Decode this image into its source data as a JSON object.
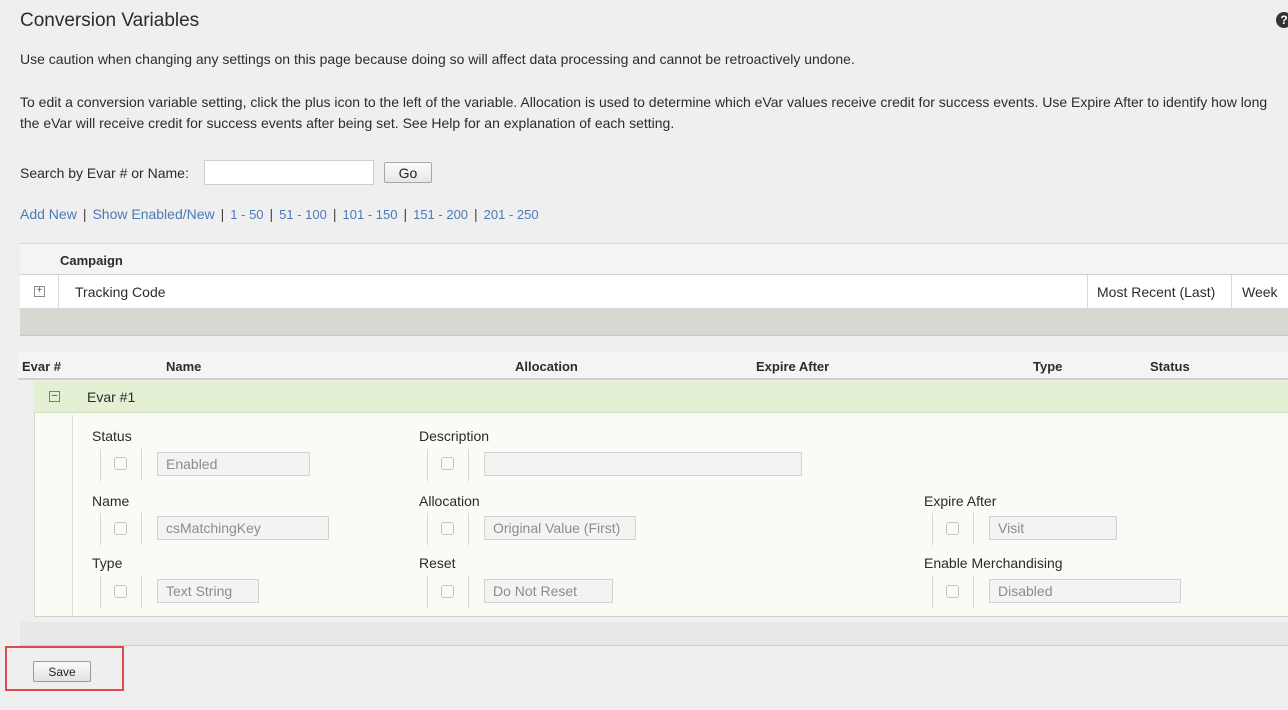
{
  "page": {
    "title": "Conversion Variables",
    "help_icon": "?",
    "caution_text": "Use caution when changing any settings on this page because doing so will affect data processing and cannot be retroactively undone.",
    "instructions_text": "To edit a conversion variable setting, click the plus icon to the left of the variable. Allocation is used to determine which eVar values receive credit for success events. Use Expire After to identify how long the eVar will receive credit for success events after being set. See Help for an explanation of each setting."
  },
  "search": {
    "label": "Search by Evar # or Name:",
    "value": "",
    "go_label": "Go"
  },
  "links": {
    "add_new": "Add New",
    "show_enabled": "Show Enabled/New",
    "ranges": [
      "1 - 50",
      "51 - 100",
      "101 - 150",
      "151 - 200",
      "201 - 250"
    ],
    "separator": "|"
  },
  "campaign": {
    "section_label": "Campaign",
    "row": {
      "expand_icon": "plus-square-icon",
      "name": "Tracking Code",
      "allocation": "Most Recent (Last)",
      "expire_after": "Week"
    }
  },
  "evar_table": {
    "columns": [
      "Evar #",
      "Name",
      "Allocation",
      "Expire After",
      "Type",
      "Status"
    ]
  },
  "evar1": {
    "title": "Evar #1",
    "collapse_icon": "minus-square-icon",
    "fields": {
      "status": {
        "label": "Status",
        "value": "Enabled"
      },
      "description": {
        "label": "Description",
        "value": ""
      },
      "name": {
        "label": "Name",
        "value": "csMatchingKey"
      },
      "allocation": {
        "label": "Allocation",
        "value": "Original Value (First)"
      },
      "expire_after": {
        "label": "Expire After",
        "value": "Visit"
      },
      "type": {
        "label": "Type",
        "value": "Text String"
      },
      "reset": {
        "label": "Reset",
        "value": "Do Not Reset"
      },
      "merchandising": {
        "label": "Enable Merchandising",
        "value": "Disabled"
      }
    }
  },
  "actions": {
    "save_label": "Save",
    "highlight_color": "#e24b4b"
  },
  "colors": {
    "link": "#4a7ab7",
    "evar_title_bg": "#e4f0d3",
    "panel_bg": "#f9fbf4",
    "page_bg": "#efefef"
  }
}
